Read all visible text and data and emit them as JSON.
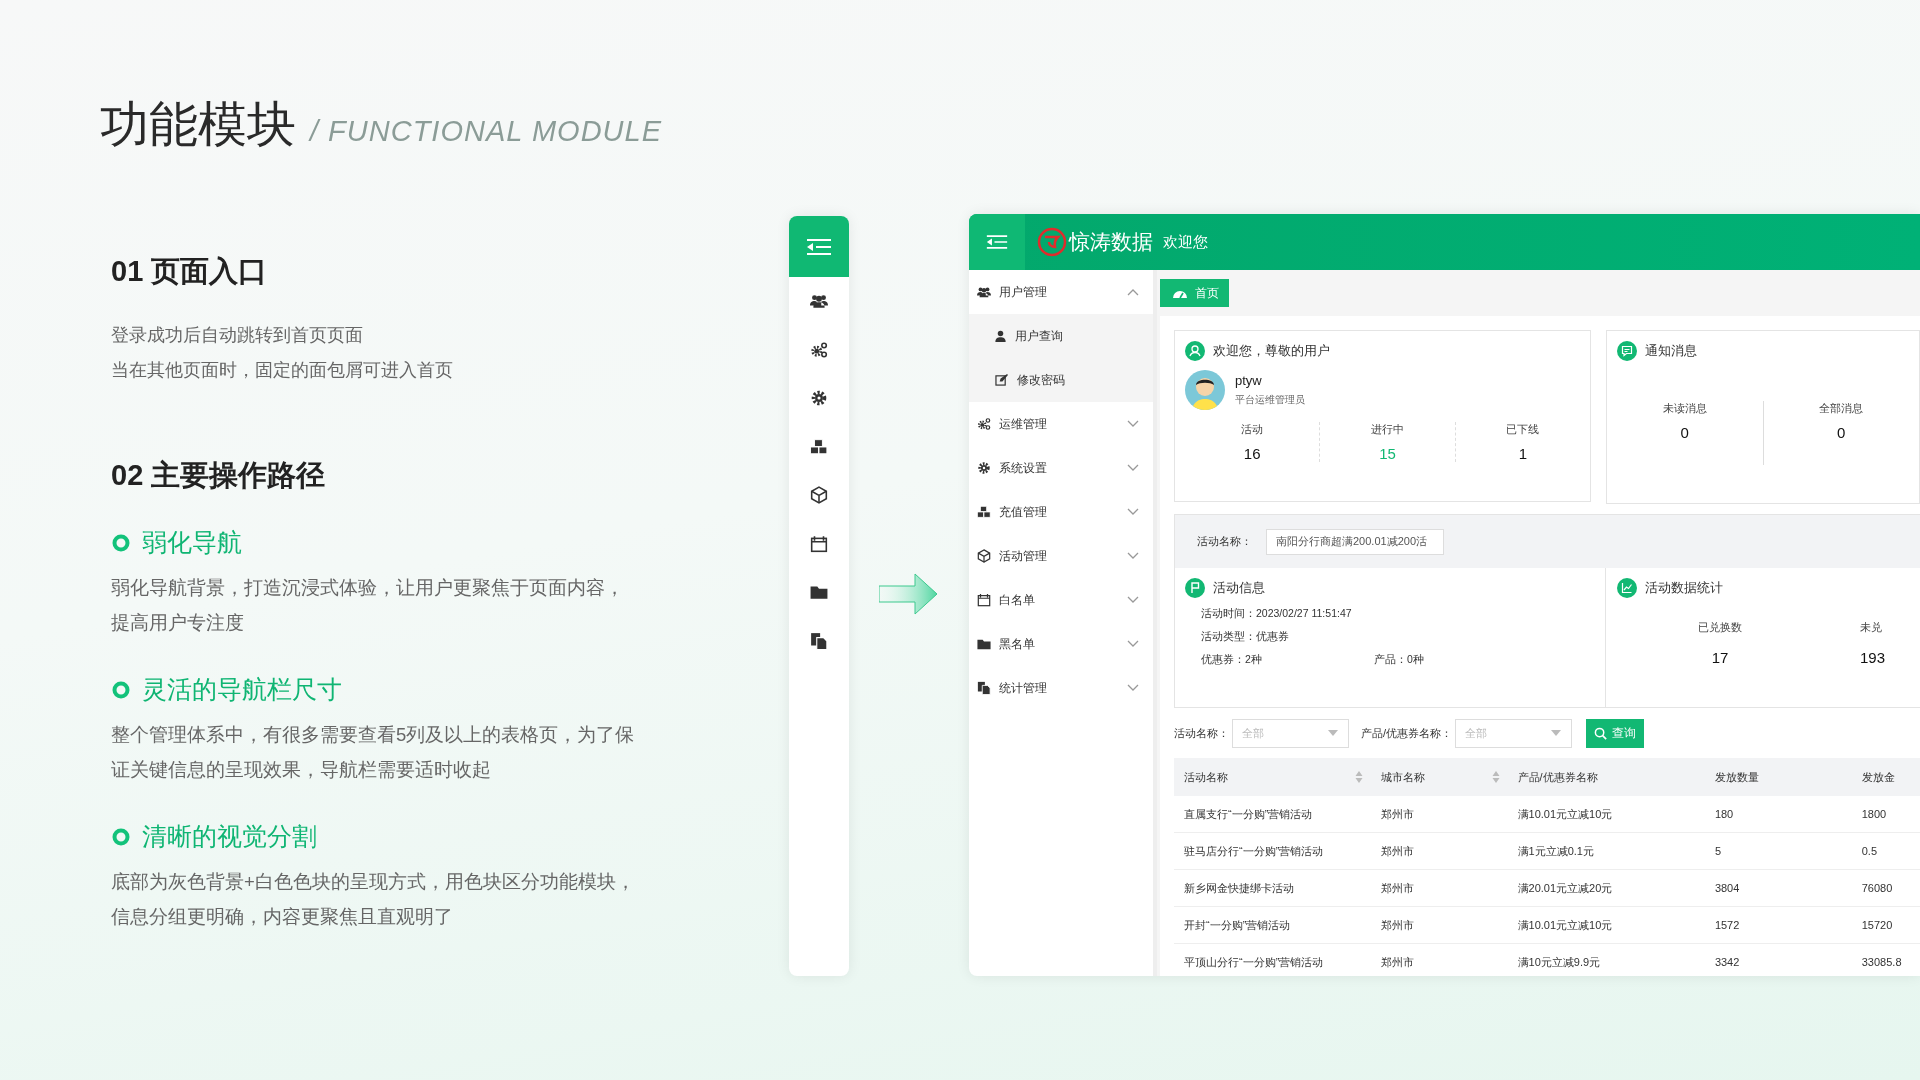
{
  "slide": {
    "title": "功能模块",
    "subtitle": "/ FUNCTIONAL MODULE",
    "section_1": {
      "heading": "01  页面入口",
      "lines": [
        "登录成功后自动跳转到首页页面",
        "当在其他页面时，固定的面包屑可进入首页"
      ]
    },
    "section_2": {
      "heading": "02  主要操作路径",
      "points": [
        {
          "title": "弱化导航",
          "text": "弱化导航背景，打造沉浸式体验，让用户更聚焦于页面内容，提高用户专注度"
        },
        {
          "title": "灵活的导航栏尺寸",
          "text": "整个管理体系中，有很多需要查看5列及以上的表格页，为了保证关键信息的呈现效果，导航栏需要适时收起"
        },
        {
          "title": "清晰的视觉分割",
          "text": "底部为灰色背景+白色色块的呈现方式，用色块区分功能模块，信息分组更明确，内容更聚焦且直观明了"
        }
      ]
    }
  },
  "app": {
    "brand": "惊涛数据",
    "greeting": "欢迎您",
    "menu": [
      {
        "label": "用户管理",
        "expanded": true,
        "children": [
          {
            "label": "用户查询"
          },
          {
            "label": "修改密码"
          }
        ]
      },
      {
        "label": "运维管理",
        "expanded": false
      },
      {
        "label": "系统设置",
        "expanded": false
      },
      {
        "label": "充值管理",
        "expanded": false
      },
      {
        "label": "活动管理",
        "expanded": false
      },
      {
        "label": "白名单",
        "expanded": false
      },
      {
        "label": "黑名单",
        "expanded": false
      },
      {
        "label": "统计管理",
        "expanded": false
      }
    ],
    "tab": "首页",
    "welcome_card": {
      "title": "欢迎您，尊敬的用户",
      "user": "ptyw",
      "role": "平台运维管理员",
      "stats": [
        {
          "label": "活动",
          "value": "16",
          "highlight": false
        },
        {
          "label": "进行中",
          "value": "15",
          "highlight": true
        },
        {
          "label": "已下线",
          "value": "1",
          "highlight": false
        }
      ]
    },
    "notice_card": {
      "title": "通知消息",
      "stats": [
        {
          "label": "未读消息",
          "value": "0"
        },
        {
          "label": "全部消息",
          "value": "0"
        }
      ]
    },
    "activity_filter": {
      "label": "活动名称：",
      "value": "南阳分行商超满200.01减200活"
    },
    "activity_info": {
      "title": "活动信息",
      "rows": [
        [
          {
            "label": "活动时间：",
            "value": "2023/02/27 11:51:47"
          }
        ],
        [
          {
            "label": "活动类型：",
            "value": "优惠券"
          }
        ],
        [
          {
            "label": "优惠券：",
            "value": "2种"
          },
          {
            "label": "产品：",
            "value": "0种"
          }
        ]
      ]
    },
    "activity_stats": {
      "title": "活动数据统计",
      "stats": [
        {
          "label": "已兑换数",
          "value": "17"
        },
        {
          "label": "未兑",
          "value": "193"
        }
      ]
    },
    "query": {
      "filters": [
        {
          "label": "活动名称：",
          "placeholder": "全部"
        },
        {
          "label": "产品/优惠券名称：",
          "placeholder": "全部"
        }
      ],
      "button": "查询"
    },
    "table": {
      "columns": [
        {
          "label": "活动名称",
          "sortable": true
        },
        {
          "label": "城市名称",
          "sortable": true
        },
        {
          "label": "产品/优惠券名称",
          "sortable": false
        },
        {
          "label": "发放数量",
          "sortable": false
        },
        {
          "label": "发放金",
          "sortable": false
        }
      ],
      "rows": [
        [
          "直属支行“一分购”营销活动",
          "郑州市",
          "满10.01元立减10元",
          "180",
          "1800"
        ],
        [
          "驻马店分行“一分购”营销活动",
          "郑州市",
          "满1元立减0.1元",
          "5",
          "0.5"
        ],
        [
          "新乡网金快捷绑卡活动",
          "郑州市",
          "满20.01元立减20元",
          "3804",
          "76080"
        ],
        [
          "开封“一分购”营销活动",
          "郑州市",
          "满10.01元立减10元",
          "1572",
          "15720"
        ],
        [
          "平顶山分行“一分购”营销活动",
          "郑州市",
          "满10元立减9.9元",
          "3342",
          "33085.8"
        ]
      ]
    }
  }
}
